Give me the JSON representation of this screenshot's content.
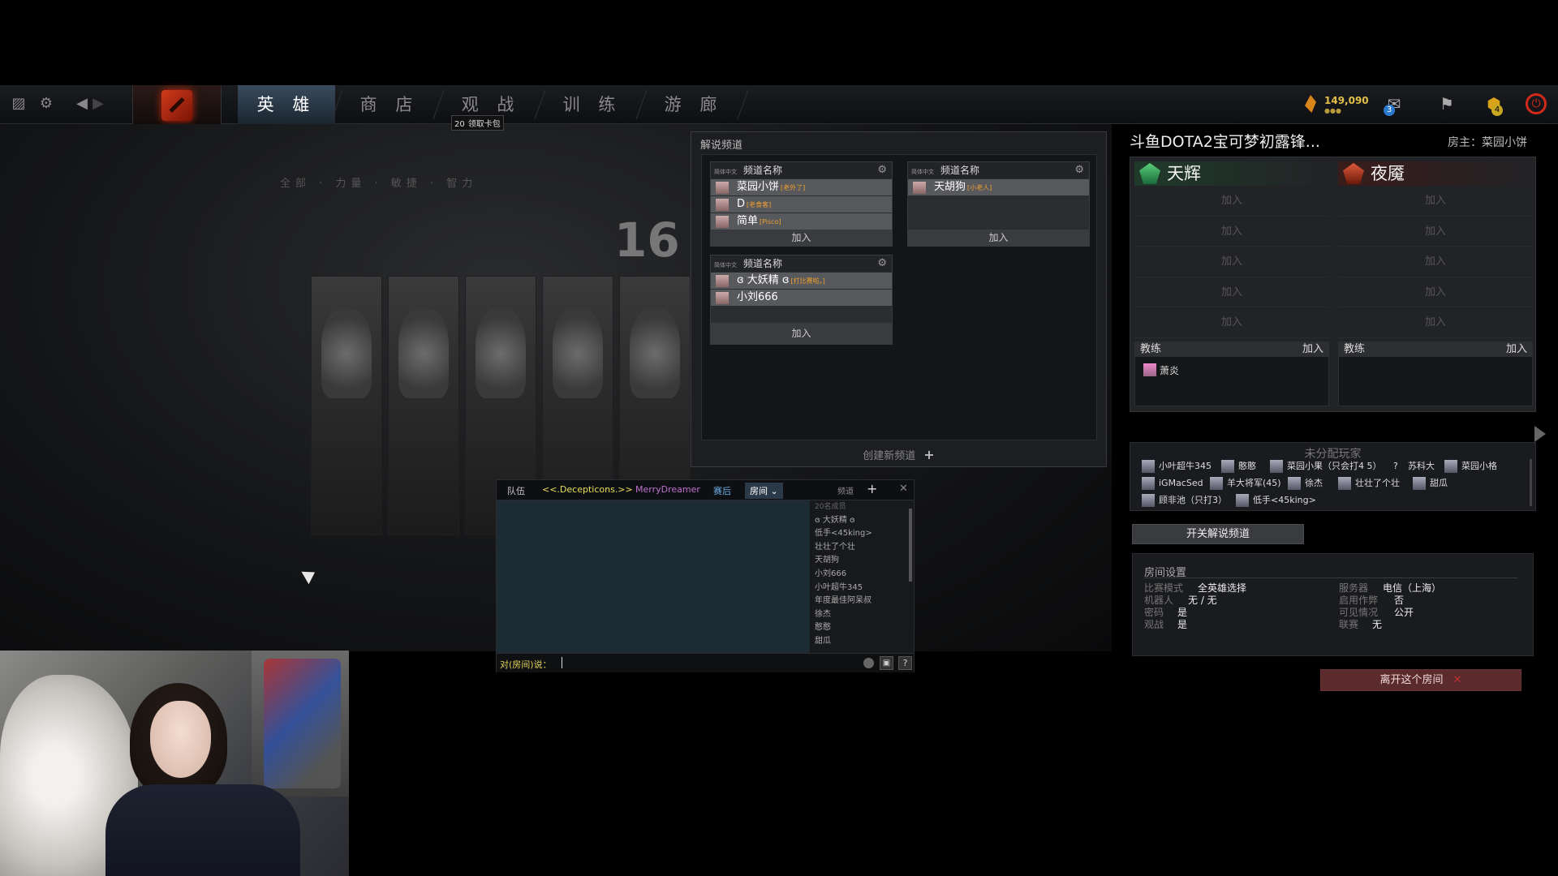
{
  "topbar": {
    "tabs": [
      "英 雄",
      "商 店",
      "观 战",
      "训 练",
      "游 廊"
    ],
    "active_tab": "英 雄",
    "shards": "149,090",
    "notice_count": "20",
    "notice_label": "领取卡包",
    "badge_1": "3",
    "badge_2": "4"
  },
  "background": {
    "filter_text": "全部 · 力量 · 敏捷 · 智力",
    "count": "16"
  },
  "caster_panel": {
    "title": "解说频道",
    "channels": [
      {
        "lang": "简体中文",
        "name": "频道名称",
        "members": [
          {
            "name": "菜园小饼",
            "note": "[老外了]"
          },
          {
            "name": "D",
            "note": "[老食客]"
          },
          {
            "name": "简单",
            "note": "[Pisco]"
          }
        ],
        "join": "加入"
      },
      {
        "lang": "简体中文",
        "name": "频道名称",
        "members": [
          {
            "name": "天胡狗",
            "note": "[小老人]"
          }
        ],
        "join": "加入"
      },
      {
        "lang": "简体中文",
        "name": "频道名称",
        "members": [
          {
            "name": "ɞ 大妖精 ɞ",
            "note": "[打比赛啦。]"
          },
          {
            "name": "小刘666",
            "note": ""
          }
        ],
        "join": "加入"
      }
    ],
    "create_label": "创建新频道",
    "create_icon": "+"
  },
  "chat": {
    "tabs": [
      "队伍",
      "<<.Decepticons.>>",
      "MerryDreamer",
      "赛后",
      "房间"
    ],
    "tab_colors": [
      "#c8c8c8",
      "#e8e05a",
      "#c070d0",
      "#6ab0e8",
      "#ffffff"
    ],
    "channel_label": "频道",
    "add_icon": "+",
    "close_icon": "✕",
    "member_count": "20名成员",
    "members": [
      "ɞ 大妖精 ɞ",
      "低手<45king>",
      "壮壮了个壮",
      "天胡狗",
      "小刘666",
      "小叶超牛345",
      "年度最佳阿呆叔",
      "徐杰",
      "憨憨",
      "甜瓜"
    ],
    "prompt": "对(房间)说：",
    "help": "?"
  },
  "lobby": {
    "title": "斗鱼DOTA2宝可梦初露锋...",
    "host": "房主：菜园小饼",
    "radiant": {
      "name": "天辉",
      "color": "#3aa05a"
    },
    "dire": {
      "name": "夜魇",
      "color": "#c03a2a"
    },
    "slot_label": "加入",
    "coach_label": "教练",
    "coach_join": "加入",
    "radiant_coach": "萧炎",
    "unassigned_title": "未分配玩家",
    "unassigned": [
      "小叶超牛345",
      "憨憨",
      "菜园小果（只会打4 5）",
      "?",
      "苏科大",
      "菜园小格",
      "iGMacSed",
      "羊大将军(45)",
      "徐杰",
      "壮壮了个壮",
      "甜瓜",
      "顾非池（只打3）",
      "低手<45king>"
    ],
    "toggle_caster": "开关解说频道",
    "room_settings": {
      "title": "房间设置",
      "rows": [
        {
          "k": "比赛模式",
          "v": "全英雄选择"
        },
        {
          "k": "机器人",
          "v": "无 / 无"
        },
        {
          "k": "密码",
          "v": "是"
        },
        {
          "k": "观战",
          "v": "是"
        },
        {
          "k": "服务器",
          "v": "电信（上海）"
        },
        {
          "k": "启用作弊",
          "v": "否"
        },
        {
          "k": "可见情况",
          "v": "公开"
        },
        {
          "k": "联赛",
          "v": "无"
        }
      ]
    },
    "leave": "离开这个房间",
    "leave_icon": "✕"
  }
}
